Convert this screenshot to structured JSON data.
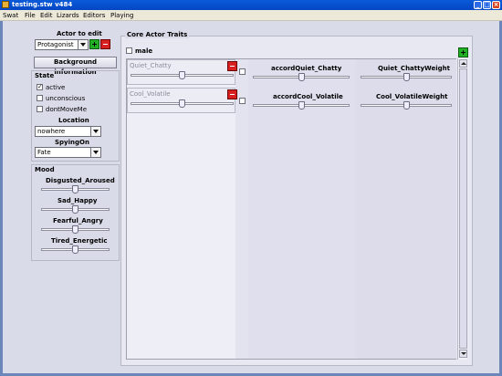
{
  "window": {
    "title": "testing.stw v484"
  },
  "menu": [
    "Swat",
    "File",
    "Edit",
    "Lizards",
    "Editors",
    "Playing"
  ],
  "actor_panel": {
    "heading": "Actor to edit",
    "selected_actor": "Protagonist",
    "background_button": "Background information"
  },
  "state": {
    "heading": "State",
    "checkboxes": [
      {
        "label": "active",
        "checked": true
      },
      {
        "label": "unconscious",
        "checked": false
      },
      {
        "label": "dontMoveMe",
        "checked": false
      }
    ],
    "location_label": "Location",
    "location_value": "nowhere",
    "spyingon_label": "SpyingOn",
    "spyingon_value": "Fate"
  },
  "mood": {
    "heading": "Mood",
    "sliders": [
      {
        "label": "Disgusted_Aroused",
        "value": 0.5
      },
      {
        "label": "Sad_Happy",
        "value": 0.5
      },
      {
        "label": "Fearful_Angry",
        "value": 0.5
      },
      {
        "label": "Tired_Energetic",
        "value": 0.5
      }
    ]
  },
  "core_traits": {
    "heading": "Core Actor Traits",
    "male_label": "male",
    "male_checked": false,
    "traits": [
      {
        "name": "Quiet_Chatty",
        "value": 0.5,
        "accord": "accordQuiet_Chatty",
        "accord_value": 0.5,
        "weight": "Quiet_ChattyWeight",
        "weight_value": 0.5
      },
      {
        "name": "Cool_Volatile",
        "value": 0.5,
        "accord": "accordCool_Volatile",
        "accord_value": 0.5,
        "weight": "Cool_VolatileWeight",
        "weight_value": 0.5
      }
    ]
  },
  "colors": {
    "add": "#22b025",
    "remove": "#d82020",
    "titlebar": "#0a5bd8"
  }
}
